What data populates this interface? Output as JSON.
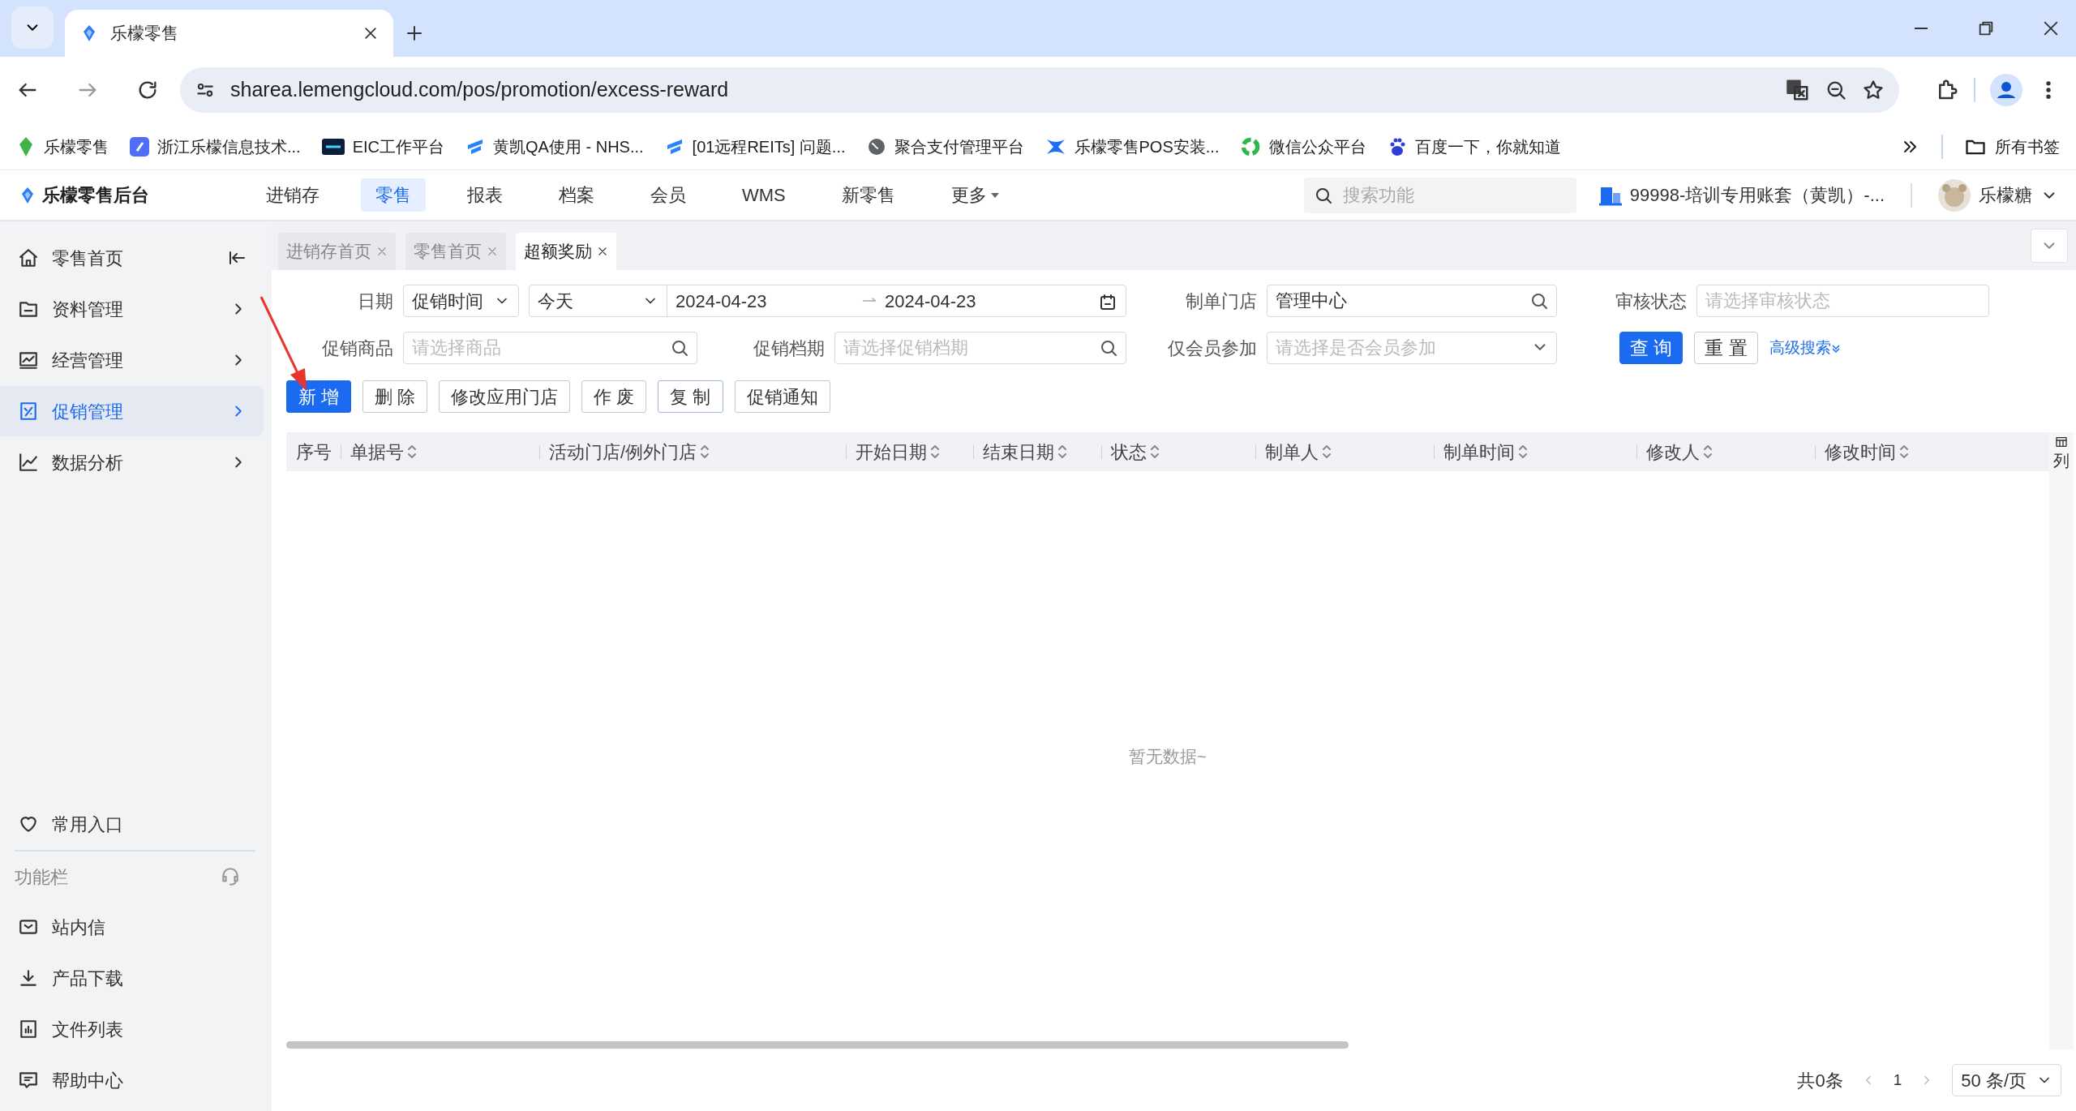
{
  "browser": {
    "tabs": [
      {
        "title": "乐檬零售",
        "selected": true
      }
    ],
    "url": "sharea.lemengcloud.com/pos/promotion/excess-reward",
    "bookmarks": [
      "乐檬零售",
      "浙江乐檬信息技术...",
      "EIC工作平台",
      "黄凯QA使用 - NHS...",
      "[01远程REITs] 问题...",
      "聚合支付管理平台",
      "乐檬零售POS安装...",
      "微信公众平台",
      "百度一下，你就知道"
    ],
    "all_bookmarks": "所有书签"
  },
  "app": {
    "brand": "乐檬零售后台",
    "nav": [
      {
        "label": "进销存",
        "selected": false,
        "has_menu": false
      },
      {
        "label": "零售",
        "selected": true,
        "has_menu": false
      },
      {
        "label": "报表",
        "selected": false,
        "has_menu": false
      },
      {
        "label": "档案",
        "selected": false,
        "has_menu": false
      },
      {
        "label": "会员",
        "selected": false,
        "has_menu": false
      },
      {
        "label": "WMS",
        "selected": false,
        "has_menu": false
      },
      {
        "label": "新零售",
        "selected": false,
        "has_menu": false
      },
      {
        "label": "更多",
        "selected": false,
        "has_menu": true
      }
    ],
    "search": {
      "placeholder": "搜索功能"
    },
    "account": "99998-培训专用账套（黄凯）-...",
    "user": "乐檬糖"
  },
  "sidebar": {
    "items": [
      {
        "label": "零售首页",
        "selected": false
      },
      {
        "label": "资料管理",
        "selected": false
      },
      {
        "label": "经营管理",
        "selected": false
      },
      {
        "label": "促销管理",
        "selected": true
      },
      {
        "label": "数据分析",
        "selected": false
      }
    ],
    "favorites": "常用入口",
    "section": "功能栏",
    "tools": [
      "站内信",
      "产品下载",
      "文件列表",
      "帮助中心"
    ]
  },
  "page_tabs": [
    {
      "label": "进销存首页",
      "selected": false
    },
    {
      "label": "零售首页",
      "selected": false
    },
    {
      "label": "超额奖励",
      "selected": true
    }
  ],
  "filters": {
    "date": {
      "label": "日期",
      "mode": "促销时间",
      "range": "今天",
      "start": "2024-04-23",
      "end": "2024-04-23"
    },
    "store": {
      "label": "制单门店",
      "value": "管理中心"
    },
    "audit": {
      "label": "审核状态",
      "placeholder": "请选择审核状态"
    },
    "product": {
      "label": "促销商品",
      "placeholder": "请选择商品"
    },
    "schedule": {
      "label": "促销档期",
      "placeholder": "请选择促销档期"
    },
    "member_only": {
      "label": "仅会员参加",
      "placeholder": "请选择是否会员参加"
    },
    "query": "查 询",
    "reset": "重 置",
    "advanced": "高级搜索"
  },
  "actions": [
    {
      "label": "新 增",
      "kind": "primary"
    },
    {
      "label": "删 除",
      "kind": "default"
    },
    {
      "label": "修改应用门店",
      "kind": "default"
    },
    {
      "label": "作 废",
      "kind": "default"
    },
    {
      "label": "复 制",
      "kind": "focused"
    },
    {
      "label": "促销通知",
      "kind": "default"
    }
  ],
  "table": {
    "columns": [
      {
        "label": "序号",
        "sortable": false
      },
      {
        "label": "单据号",
        "sortable": true
      },
      {
        "label": "活动门店/例外门店",
        "sortable": true
      },
      {
        "label": "开始日期",
        "sortable": true
      },
      {
        "label": "结束日期",
        "sortable": true
      },
      {
        "label": "状态",
        "sortable": true
      },
      {
        "label": "制单人",
        "sortable": true
      },
      {
        "label": "制单时间",
        "sortable": true
      },
      {
        "label": "修改人",
        "sortable": true
      },
      {
        "label": "修改时间",
        "sortable": true
      }
    ],
    "column_settings": "列",
    "empty": "暂无数据~"
  },
  "pagination": {
    "total": "共0条",
    "page": "1",
    "page_size": "50 条/页"
  }
}
